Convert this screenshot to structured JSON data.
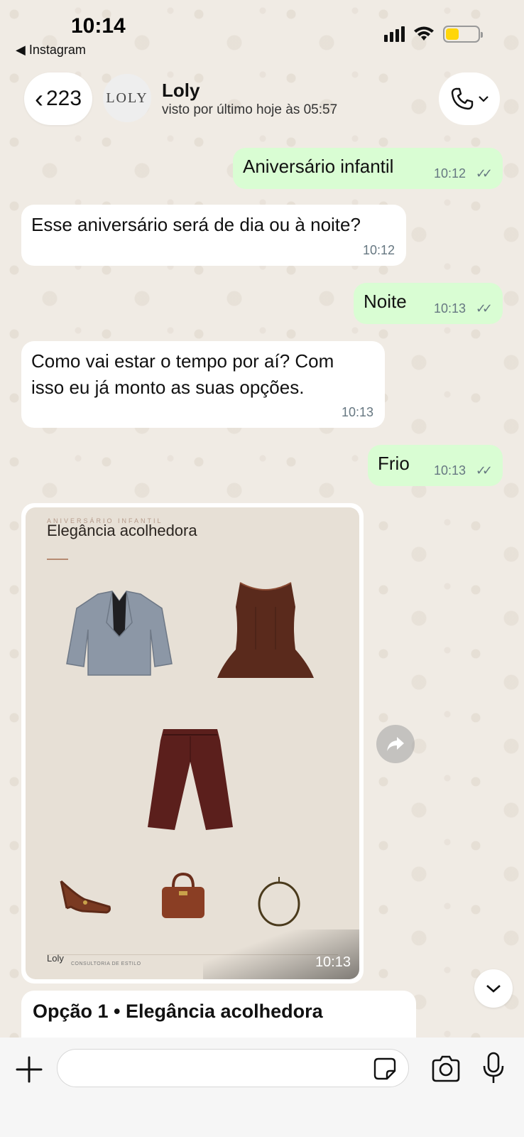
{
  "status_bar": {
    "time": "10:14",
    "back_app": "◀ Instagram"
  },
  "header": {
    "back_count": "223",
    "avatar_text": "LOLY",
    "contact_name": "Loly",
    "contact_status": "visto por último hoje às 05:57"
  },
  "messages": [
    {
      "dir": "out",
      "text": "Aniversário infantil",
      "time": "10:12"
    },
    {
      "dir": "in",
      "text": "Esse aniversário será de dia ou à noite?",
      "time": "10:12"
    },
    {
      "dir": "out",
      "text": "Noite",
      "time": "10:13"
    },
    {
      "dir": "in",
      "text": "Como vai estar o tempo por aí? Com isso eu já monto as suas opções.",
      "time": "10:13"
    },
    {
      "dir": "out",
      "text": "Frio",
      "time": "10:13"
    }
  ],
  "image_message": {
    "kicker": "ANIVERSÁRIO INFANTIL",
    "title": "Elegância acolhedora",
    "brand": "Loly",
    "brand_sub": "CONSULTORIA DE ESTILO",
    "time": "10:13",
    "items": [
      "blazer",
      "peplum-top",
      "wide-trousers",
      "slingback-heels",
      "handbag",
      "necklace"
    ]
  },
  "caption": "Opção 1 • Elegância acolhedora",
  "colors": {
    "outgoing_bubble": "#d9fdd3",
    "incoming_bubble": "#ffffff",
    "wallpaper": "#f0ebe4",
    "battery": "#ffd60a"
  }
}
